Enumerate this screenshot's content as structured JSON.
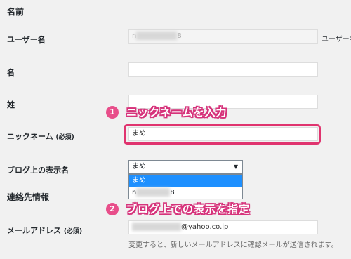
{
  "sections": {
    "name_title": "名前",
    "contact_title": "連絡先情報"
  },
  "fields": {
    "username": {
      "label": "ユーザー名",
      "value_prefix": "n",
      "value_suffix": "8",
      "side_note": "ユーザー名"
    },
    "first_name": {
      "label": "名",
      "value": ""
    },
    "last_name": {
      "label": "姓",
      "value": ""
    },
    "nickname": {
      "label": "ニックネーム",
      "required": "(必須)",
      "value": "まめ"
    },
    "display_name": {
      "label": "ブログ上の表示名",
      "selected": "まめ",
      "options": [
        {
          "label": "まめ"
        },
        {
          "prefix": "n",
          "suffix": "8"
        }
      ]
    },
    "email": {
      "label": "メールアドレス",
      "required": "(必須)",
      "value_domain": "@yahoo.co.jp"
    }
  },
  "help": {
    "email_note": "変更すると、新しいメールアドレスに確認メールが送信されます。"
  },
  "annotations": [
    {
      "number": "1",
      "text": "ニックネームを入力"
    },
    {
      "number": "2",
      "text": "ブログ上での表示を指定"
    }
  ],
  "colors": {
    "accent_pink": "#e0346f",
    "select_highlight": "#1e90ff"
  },
  "icons": {
    "dropdown": "caret-down-icon"
  }
}
